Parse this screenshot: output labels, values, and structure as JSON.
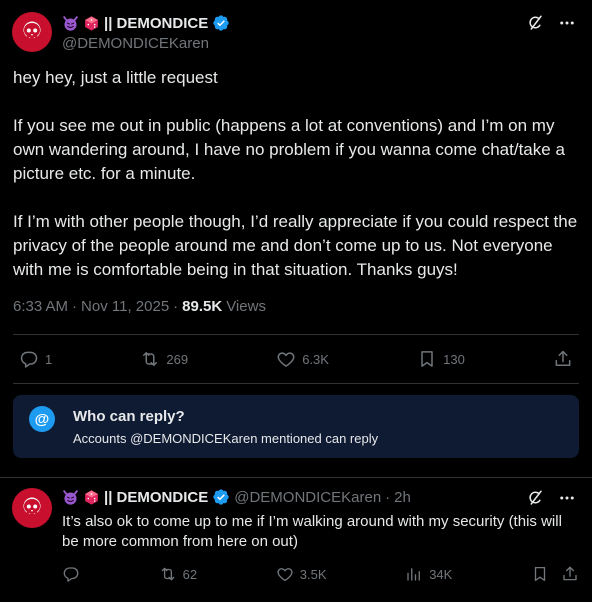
{
  "main_tweet": {
    "display_name": "|| DEMONDICE",
    "handle": "@DEMONDICEKaren",
    "text": "hey hey, just a little request\n\nIf you see me out in public (happens a lot at conventions) and I’m on my own wandering around, I have no problem if you wanna come chat/take a picture etc. for a minute.\n\nIf I’m with other people though, I’d really appreciate if you could respect the privacy of the people around me and don’t come up to us. Not everyone with me is comfortable being in that situation. Thanks guys!",
    "time": "6:33 AM",
    "date": "Nov 11, 2025",
    "views_count": "89.5K",
    "views_label": "Views",
    "stats": {
      "replies": "1",
      "reposts": "269",
      "likes": "6.3K",
      "bookmarks": "130"
    }
  },
  "reply_restriction": {
    "title": "Who can reply?",
    "subtitle": "Accounts @DEMONDICEKaren mentioned can reply",
    "icon_text": "@"
  },
  "reply_tweet": {
    "display_name": "|| DEMONDICE",
    "handle": "@DEMONDICEKaren",
    "time_ago": "2h",
    "text": "It’s also ok to come up to me if I’m walking around with my security (this will be more common from here on out)",
    "stats": {
      "replies": "",
      "reposts": "62",
      "likes": "3.5K",
      "views": "34K"
    }
  },
  "colors": {
    "background": "#000000",
    "text": "#e7e9ea",
    "muted": "#71767b",
    "accent": "#1d9bf0",
    "divider": "#2f3336",
    "avatar_red": "#c8102e"
  },
  "icons": [
    "smiling-devil-emoji",
    "red-die-emoji",
    "verified-badge-icon",
    "grok-icon",
    "more-icon",
    "reply-icon",
    "repost-icon",
    "like-icon",
    "bookmark-icon",
    "share-icon",
    "views-icon",
    "at-icon"
  ]
}
